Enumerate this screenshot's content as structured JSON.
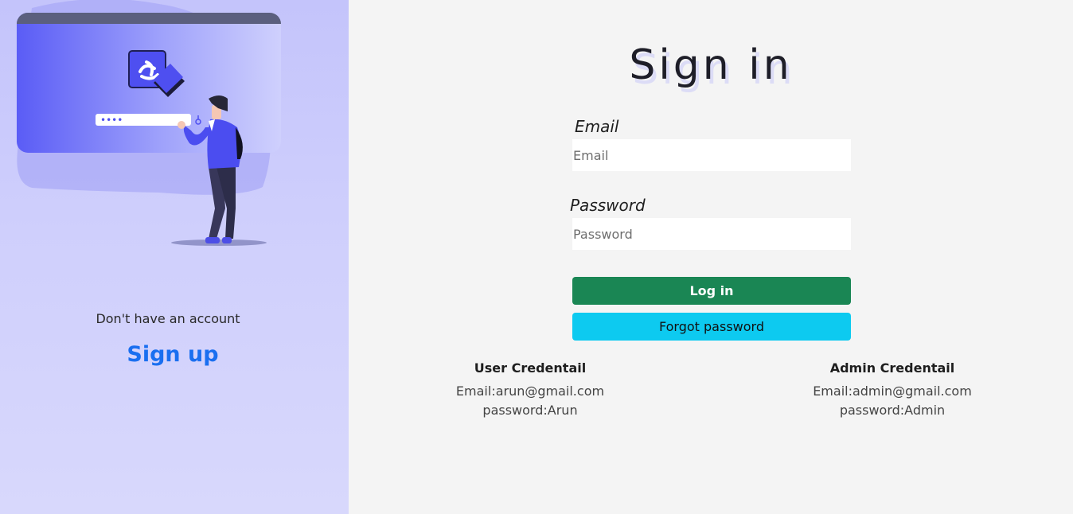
{
  "sidebar": {
    "no_account_text": "Don't have an account",
    "signup_label": "Sign up",
    "password_dots": "••••"
  },
  "form": {
    "title": "Sign in",
    "email_label": "Email",
    "email_placeholder": "Email",
    "password_label": "Password",
    "password_placeholder": "Password",
    "login_label": "Log in",
    "forgot_label": "Forgot password"
  },
  "credentials": {
    "user": {
      "heading": "User Credentail",
      "email": "Email:arun@gmail.com",
      "password": "password:Arun"
    },
    "admin": {
      "heading": "Admin Credentail",
      "email": "Email:admin@gmail.com",
      "password": "password:Admin"
    }
  },
  "colors": {
    "login_button": "#1a8654",
    "forgot_button": "#0dcaf0",
    "signup_link": "#1a6ff0",
    "panel": "#c4c4fb"
  }
}
